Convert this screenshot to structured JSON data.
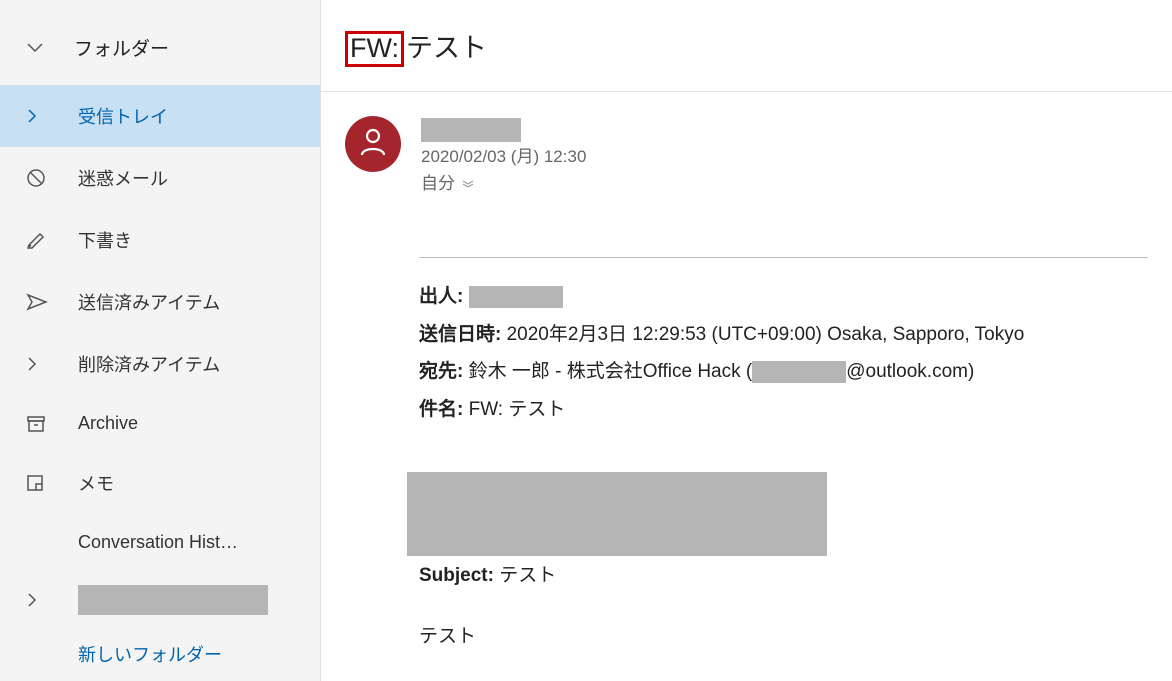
{
  "sidebar": {
    "header": "フォルダー",
    "items": {
      "inbox": "受信トレイ",
      "junk": "迷惑メール",
      "drafts": "下書き",
      "sent": "送信済みアイテム",
      "deleted": "削除済みアイテム",
      "archive": "Archive",
      "notes": "メモ",
      "conv": "Conversation Hist…"
    },
    "new_folder": "新しいフォルダー"
  },
  "message": {
    "subject_prefix": "FW:",
    "subject_rest": " テスト",
    "date": "2020/02/03 (月) 12:30",
    "to_self": "自分",
    "headers": {
      "from_label": "出人:",
      "sent_label": "送信日時:",
      "sent_value": "2020年2月3日 12:29:53 (UTC+09:00) Osaka, Sapporo, Tokyo",
      "to_label": "宛先:",
      "to_name": "鈴木 一郎 - 株式会社Office Hack (",
      "to_email_suffix": "@outlook.com)",
      "subj_label": "件名:",
      "subj_value": "FW: テスト"
    },
    "nested": {
      "subject_label": "Subject:",
      "subject_value": "テスト",
      "body": "テスト"
    }
  }
}
